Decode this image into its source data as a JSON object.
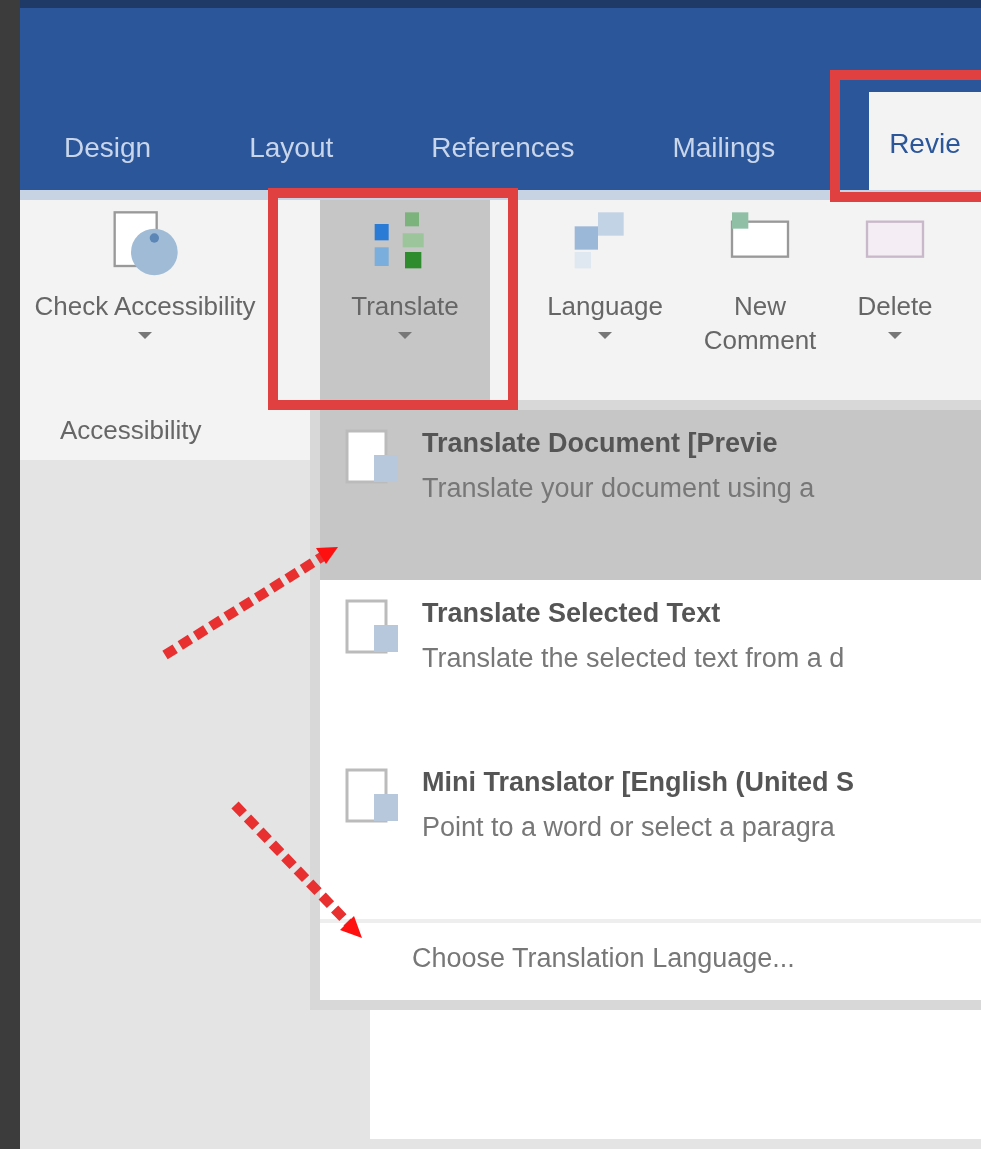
{
  "ribbon_tabs": [
    {
      "label": "Design",
      "selected": false
    },
    {
      "label": "Layout",
      "selected": false
    },
    {
      "label": "References",
      "selected": false
    },
    {
      "label": "Mailings",
      "selected": false
    },
    {
      "label": "Revie",
      "selected": true
    }
  ],
  "ribbon_buttons": [
    {
      "kind": "accessibility",
      "label": "Check Accessibility",
      "dropdown": true,
      "expanded": false
    },
    {
      "kind": "translate",
      "label": "Translate",
      "dropdown": true,
      "expanded": true
    },
    {
      "kind": "language",
      "label": "Language",
      "dropdown": true,
      "expanded": false
    },
    {
      "kind": "comment",
      "label": "New Comment",
      "dropdown": false,
      "expanded": false
    },
    {
      "kind": "delete",
      "label": "Delete",
      "dropdown": true,
      "expanded": false
    }
  ],
  "group_label": "Accessibility",
  "translate_menu": {
    "items": [
      {
        "title": "Translate Document [Previe",
        "description": "Translate your document using a",
        "selected": true
      },
      {
        "title": "Translate Selected Text",
        "description": "Translate the selected text from a d",
        "selected": false
      },
      {
        "title": "Mini Translator [English (United S",
        "description": "Point to a word or select a paragra",
        "selected": false
      }
    ],
    "footer": "Choose Translation Language..."
  }
}
